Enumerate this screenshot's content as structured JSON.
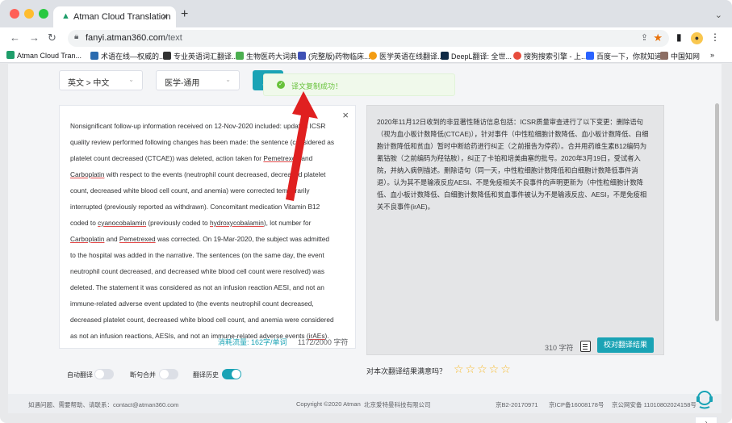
{
  "browser": {
    "tab_title": "Atman Cloud Translation",
    "url_host": "fanyi.atman360.com",
    "url_path": "/text"
  },
  "bookmarks": [
    {
      "label": "Atman Cloud Tran...",
      "color": "#1e9d6a"
    },
    {
      "label": "术语在线—权威的...",
      "color": "#2b6cb0"
    },
    {
      "label": "专业英语词汇翻译...",
      "color": "#333333"
    },
    {
      "label": "生物医药大词典",
      "color": "#4caf50"
    },
    {
      "label": "(完整版)药物临床...",
      "color": "#3f51b5"
    },
    {
      "label": "医学英语在线翻译...",
      "color": "#f39c12"
    },
    {
      "label": "DeepL翻译: 全世...",
      "color": "#0f2b46"
    },
    {
      "label": "搜狗搜索引擎 - 上...",
      "color": "#e74c3c"
    },
    {
      "label": "百度一下，你就知道",
      "color": "#2962ff"
    },
    {
      "label": "中国知网",
      "color": "#8d6e63"
    }
  ],
  "controls": {
    "language_pair": "英文 > 中文",
    "domain": "医学-通用",
    "translate_button": "立",
    "toast": "译文复制成功！"
  },
  "source": {
    "segments": [
      {
        "t": "Nonsignificant follow-up information received on 12-Nov-2020 included: updated ICSR quality review performed following changes has been made: the sentence (considered as platelet count decreased (CTCAE)) was deleted, action taken for ",
        "u": false
      },
      {
        "t": "Pemetrexed",
        "u": true
      },
      {
        "t": " and ",
        "u": false
      },
      {
        "t": "Carboplatin",
        "u": true
      },
      {
        "t": " with respect to the events (neutrophil count decreased, decreased platelet count, decreased white blood cell count, and anemia) were corrected temporarily interrupted (previously reported as withdrawn). Concomitant medication Vitamin B12 coded to ",
        "u": false
      },
      {
        "t": "cyanocobalamin",
        "u": true
      },
      {
        "t": " (previously coded to ",
        "u": false
      },
      {
        "t": "hydroxycobalamin",
        "u": true
      },
      {
        "t": "), lot number for ",
        "u": false
      },
      {
        "t": "Carboplatin",
        "u": true
      },
      {
        "t": " and ",
        "u": false
      },
      {
        "t": "Pemetrexed",
        "u": true
      },
      {
        "t": " was corrected. On 19-Mar-2020, the subject was admitted to the hospital was added in the narrative. The sentences (on the same day, the event neutrophil count decreased, and decreased white blood cell count were resolved) was deleted. The statement it was considered as not an infusion reaction AESI, and not an immune-related adverse event updated to (the events neutrophil count decreased, decreased platelet count, decreased white blood cell count, and anemia were considered as not an infusion reactions, AESIs, and not an immune-related adverse events (",
        "u": false
      },
      {
        "t": "irAEs",
        "u": true
      },
      {
        "t": ").",
        "u": false
      }
    ],
    "usage": "消耗流量: 162字/单词",
    "char_count": "1172/2000 字符"
  },
  "target": {
    "text": "2020年11月12日收到的非显著性随访信息包括：ICSR质量审查进行了以下变更：删除语句（视为血小板计数降低(CTCAE)），针对事件（中性粒细胞计数降低、血小板计数降低、白细胞计数降低和贫血）暂时中断给药进行纠正（之前报告为停药）。合并用药维生素B12编码为氰钴胺（之前编码为羟钴胺），纠正了卡铂和培美曲塞的批号。2020年3月19日，受试者入院，并纳入病例描述。删除语句（同一天，中性粒细胞计数降低和白细胞计数降低事件消退）。认为其不是输液反应AESI、不是免疫相关不良事件的声明更新为（中性粒细胞计数降低、血小板计数降低、白细胞计数降低和贫血事件被认为不是输液反应、AESI，不是免疫相关不良事件(irAE)。",
    "char_count": "310 字符",
    "proofread_button": "校对翻译结果"
  },
  "options": {
    "auto_translate": "自动翻译",
    "merge_sentences": "断句合并",
    "history": "翻译历史",
    "auto_translate_on": false,
    "merge_sentences_on": false,
    "history_on": true
  },
  "rating": {
    "question": "对本次翻译结果满意吗？",
    "stars": "☆☆☆☆☆"
  },
  "footer": {
    "contact": "如遇问题、需要帮助、请联系：contact@atman360.com",
    "copyright": "Copyright ©2020 Atman",
    "company": "北京爱特曼科技有限公司",
    "icp1": "京B2-20170971",
    "icp2": "京ICP备16008178号",
    "police": "京公网安备 11010802024158号"
  },
  "colors": {
    "accent": "#1aa3b5",
    "success": "#67c23a",
    "arrow": "#e02020"
  }
}
